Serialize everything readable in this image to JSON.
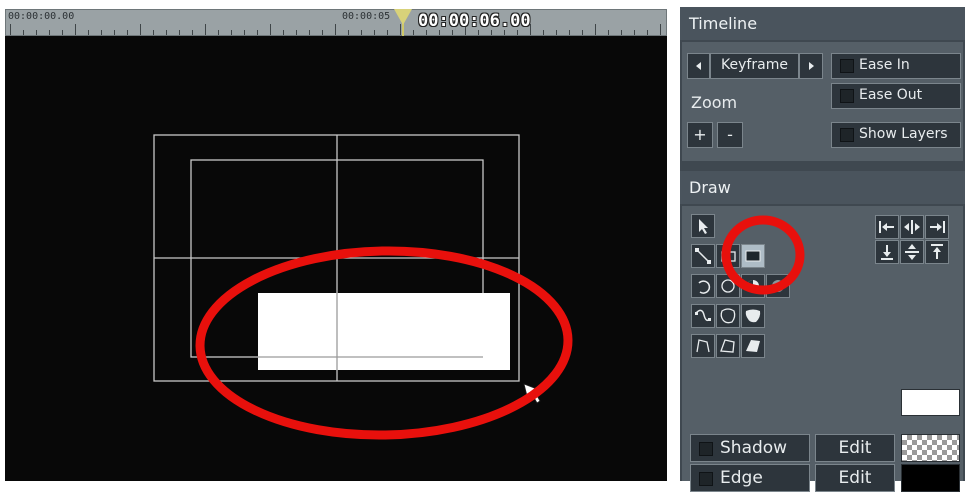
{
  "timeline_ruler": {
    "start_label": "00:00:00.00",
    "mid_label": "00:00:05",
    "current_time": "00:00:06.00"
  },
  "timeline_panel": {
    "title": "Timeline",
    "keyframe_label": "Keyframe",
    "prev_icon": "triangle-left-icon",
    "next_icon": "triangle-right-icon",
    "ease_in_label": "Ease In",
    "ease_out_label": "Ease Out",
    "zoom_label": "Zoom",
    "zoom_in_label": "+",
    "zoom_out_label": "-",
    "show_layers_label": "Show Layers"
  },
  "draw_panel": {
    "title": "Draw",
    "tools": [
      "select-arrow-icon",
      "line-icon",
      "rectangle-outline-icon",
      "rectangle-filled-icon",
      "arc-icon",
      "circle-icon",
      "pie-icon",
      "circle-filled-icon",
      "curve-icon",
      "curved-polygon-icon",
      "curved-polygon-filled-icon",
      "polyline-icon",
      "polygon-icon",
      "polygon-filled-icon"
    ],
    "align_tools": [
      "align-left-icon",
      "align-center-horizontal-icon",
      "align-right-icon",
      "align-bottom-icon",
      "align-center-vertical-icon",
      "align-top-icon"
    ],
    "fill_color": "#ffffff",
    "shadow_label": "Shadow",
    "edge_label": "Edge",
    "edit_label": "Edit",
    "shadow_swatch": "checkerboard",
    "edge_color": "#000000"
  },
  "colors": {
    "annotation_red": "#e8100c",
    "panel_bg": "#3f4850",
    "canvas_bg": "#080808"
  }
}
